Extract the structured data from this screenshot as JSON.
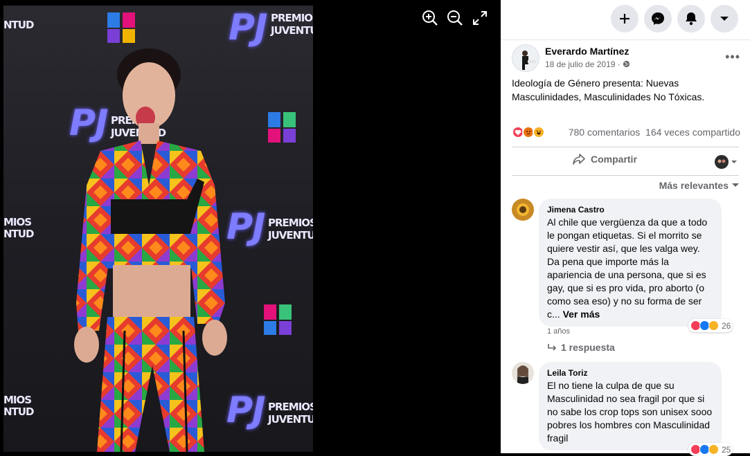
{
  "viewer": {
    "watermarks": {
      "brand_big": "PJ",
      "brand_small_1": "PREMIOS",
      "brand_small_2": "JUVENTUD",
      "edge_small_1": "MIOS",
      "edge_small_2": "NTUD"
    },
    "tools": [
      "zoom-in-icon",
      "zoom-out-icon",
      "fullscreen-icon"
    ]
  },
  "topbar": {
    "buttons": [
      "plus-icon",
      "messenger-icon",
      "bell-icon",
      "caret-down-icon"
    ]
  },
  "post": {
    "author": "Everardo Martínez",
    "date": "18 de julio de 2019 ·",
    "text": "Ideología de Género presenta: Nuevas Masculinidades, Masculinidades No Tóxicas.",
    "comments_count": "780 comentarios",
    "shares_count": "164 veces compartido",
    "share_label": "Compartir",
    "sort_label": "Más relevantes",
    "reactions": [
      "love",
      "angry",
      "haha"
    ]
  },
  "comments": [
    {
      "name": "Jimena Castro",
      "body": "Al chile que vergüenza da que a todo le pongan etiquetas. Si el morrito se quiere vestir así, que les valga wey. Da pena que importe más la apariencia de una persona, que si es gay, que si es pro vida, pro aborto (o como sea eso) y no su forma de ser c...",
      "more": "Ver más",
      "reaction_count": "26",
      "time": "1 años",
      "replies": "1 respuesta"
    },
    {
      "name": "Leila Toriz",
      "body": "El no tiene la culpa de que su Masculinidad no sea fragil por que si no sabe los crop tops son unisex sooo pobres los hombres con Masculinidad fragil",
      "reaction_count": "25"
    }
  ],
  "colors": {
    "panel_bg": "#ffffff",
    "bubble_bg": "#f0f2f5",
    "secondary_text": "#65676b",
    "viewer_bg": "#000000"
  }
}
